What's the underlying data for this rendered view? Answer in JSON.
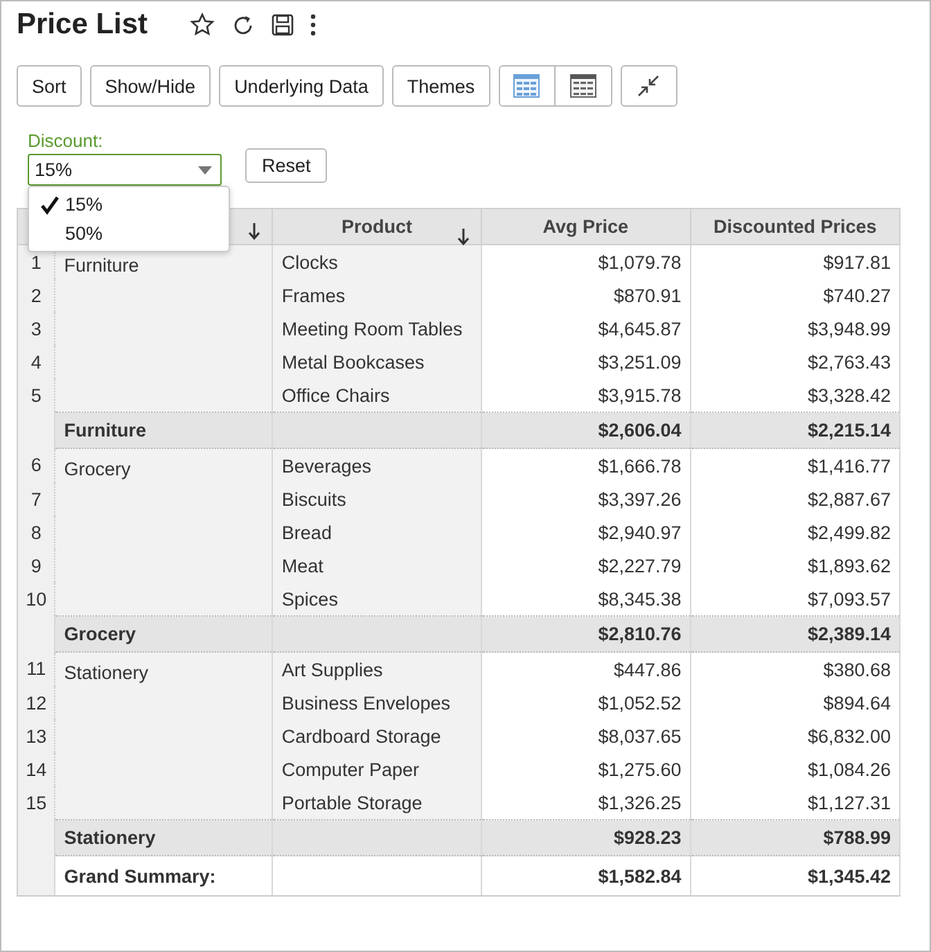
{
  "title": "Price List",
  "toolbar": {
    "buttons": [
      "Sort",
      "Show/Hide",
      "Underlying Data",
      "Themes"
    ]
  },
  "filter": {
    "label": "Discount:",
    "value": "15%",
    "reset": "Reset",
    "options": [
      {
        "label": "15%",
        "selected": true
      },
      {
        "label": "50%",
        "selected": false
      }
    ]
  },
  "table": {
    "columns": [
      {
        "sortable": true
      },
      {
        "label": "Product",
        "sortable": true
      },
      {
        "label": "Avg Price",
        "sortable": false
      },
      {
        "label": "Discounted Prices",
        "sortable": false
      }
    ],
    "groups": [
      {
        "category": "Furniture",
        "rows": [
          {
            "num": "1",
            "product": "Clocks",
            "avg": "$1,079.78",
            "disc": "$917.81"
          },
          {
            "num": "2",
            "product": "Frames",
            "avg": "$870.91",
            "disc": "$740.27"
          },
          {
            "num": "3",
            "product": "Meeting Room Tables",
            "avg": "$4,645.87",
            "disc": "$3,948.99"
          },
          {
            "num": "4",
            "product": "Metal Bookcases",
            "avg": "$3,251.09",
            "disc": "$2,763.43"
          },
          {
            "num": "5",
            "product": "Office Chairs",
            "avg": "$3,915.78",
            "disc": "$3,328.42"
          }
        ],
        "subtotal": {
          "label": "Furniture",
          "avg": "$2,606.04",
          "disc": "$2,215.14"
        }
      },
      {
        "category": "Grocery",
        "rows": [
          {
            "num": "6",
            "product": "Beverages",
            "avg": "$1,666.78",
            "disc": "$1,416.77"
          },
          {
            "num": "7",
            "product": "Biscuits",
            "avg": "$3,397.26",
            "disc": "$2,887.67"
          },
          {
            "num": "8",
            "product": "Bread",
            "avg": "$2,940.97",
            "disc": "$2,499.82"
          },
          {
            "num": "9",
            "product": "Meat",
            "avg": "$2,227.79",
            "disc": "$1,893.62"
          },
          {
            "num": "10",
            "product": "Spices",
            "avg": "$8,345.38",
            "disc": "$7,093.57"
          }
        ],
        "subtotal": {
          "label": "Grocery",
          "avg": "$2,810.76",
          "disc": "$2,389.14"
        }
      },
      {
        "category": "Stationery",
        "rows": [
          {
            "num": "11",
            "product": "Art Supplies",
            "avg": "$447.86",
            "disc": "$380.68"
          },
          {
            "num": "12",
            "product": "Business Envelopes",
            "avg": "$1,052.52",
            "disc": "$894.64"
          },
          {
            "num": "13",
            "product": "Cardboard Storage",
            "avg": "$8,037.65",
            "disc": "$6,832.00"
          },
          {
            "num": "14",
            "product": "Computer Paper",
            "avg": "$1,275.60",
            "disc": "$1,084.26"
          },
          {
            "num": "15",
            "product": "Portable Storage",
            "avg": "$1,326.25",
            "disc": "$1,127.31"
          }
        ],
        "subtotal": {
          "label": "Stationery",
          "avg": "$928.23",
          "disc": "$788.99"
        }
      }
    ],
    "grand": {
      "label": "Grand Summary:",
      "avg": "$1,582.84",
      "disc": "$1,345.42"
    }
  }
}
